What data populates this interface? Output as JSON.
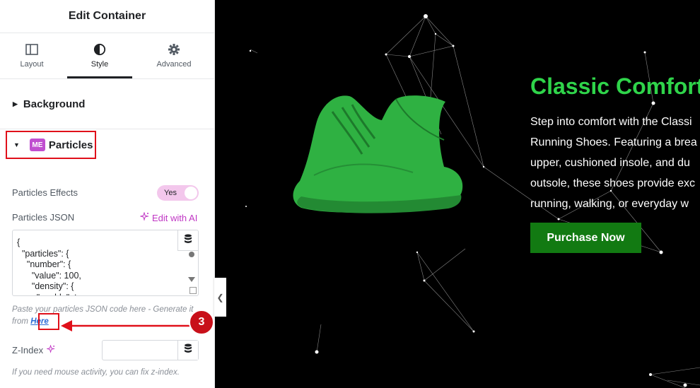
{
  "panel": {
    "title": "Edit Container",
    "tabs": [
      {
        "label": "Layout",
        "icon": "layout-icon"
      },
      {
        "label": "Style",
        "icon": "contrast-icon"
      },
      {
        "label": "Advanced",
        "icon": "gear-icon"
      }
    ],
    "background_label": "Background",
    "particles_label": "Particles",
    "particles_effects_label": "Particles Effects",
    "toggle_value": "Yes",
    "particles_json_label": "Particles JSON",
    "edit_ai_label": "Edit with AI",
    "json_code": "{\n  \"particles\": {\n    \"number\": {\n      \"value\": 100,\n      \"density\": {\n        \"enable\": true,",
    "hint_before": "Paste your particles JSON code here - Generate it from",
    "hint_link": "Here",
    "zindex_label": "Z-Index",
    "zindex_hint": "If you need mouse activity, you can fix z-index."
  },
  "annotation": {
    "number": "3"
  },
  "preview": {
    "title": "Classic Comfort",
    "lines": [
      "Step into comfort with the Classi",
      "Running Shoes. Featuring a brea",
      "upper, cushioned insole, and du",
      "outsole, these shoes provide exc",
      "running, walking, or everyday w"
    ],
    "button_label": "Purchase Now"
  },
  "colors": {
    "accent": "#c036c4",
    "highlight": "#e0101a",
    "title_green": "#2fd44a",
    "button_green": "#127a12"
  }
}
